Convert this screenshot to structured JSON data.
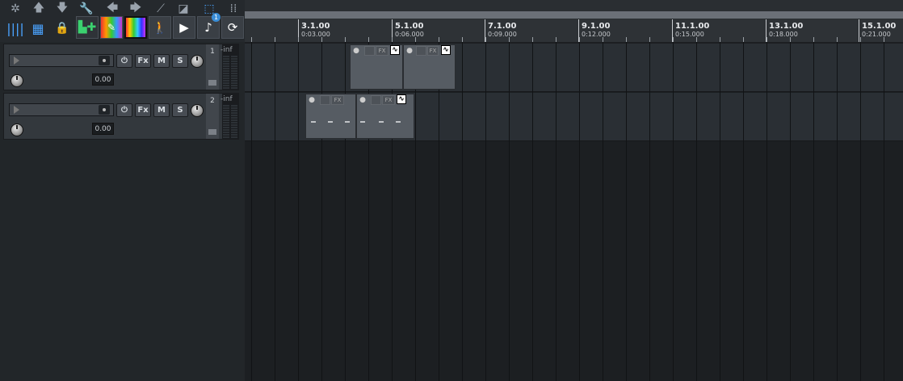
{
  "toolbar": {
    "top_icons": [
      "snap-icon",
      "arrow-up-icon",
      "arrow-down-icon",
      "wrench-icon",
      "arrow-left-icon",
      "arrow-right-icon",
      "ripple-icon",
      "envelope-icon",
      "grid-dots-icon"
    ],
    "buttons": [
      "grid-lines-icon",
      "grid-icon",
      "lock-icon",
      "add-track-icon",
      "color-icon",
      "color-swatch-icon",
      "walk-icon",
      "play-icon",
      "extensions-icon",
      "refresh-icon"
    ],
    "badge": "1"
  },
  "tracks": [
    {
      "number": "1",
      "volume": "0.00",
      "meter": "-inf",
      "fx": "Fx",
      "mute": "M",
      "solo": "S"
    },
    {
      "number": "2",
      "volume": "0.00",
      "meter": "-inf",
      "fx": "Fx",
      "mute": "M",
      "solo": "S"
    }
  ],
  "ruler": {
    "markers": [
      {
        "bar": "3.1.00",
        "time": "0:03.000"
      },
      {
        "bar": "5.1.00",
        "time": "0:06.000"
      },
      {
        "bar": "7.1.00",
        "time": "0:09.000"
      },
      {
        "bar": "9.1.00",
        "time": "0:12.000"
      },
      {
        "bar": "11.1.00",
        "time": "0:15.000"
      },
      {
        "bar": "13.1.00",
        "time": "0:18.000"
      },
      {
        "bar": "15.1.00",
        "time": "0:21.000"
      }
    ]
  },
  "item_labels": {
    "fx": "FX"
  },
  "colors": {
    "accent_green": "#3bd16f",
    "meter_bg": "#1a1c1f"
  }
}
